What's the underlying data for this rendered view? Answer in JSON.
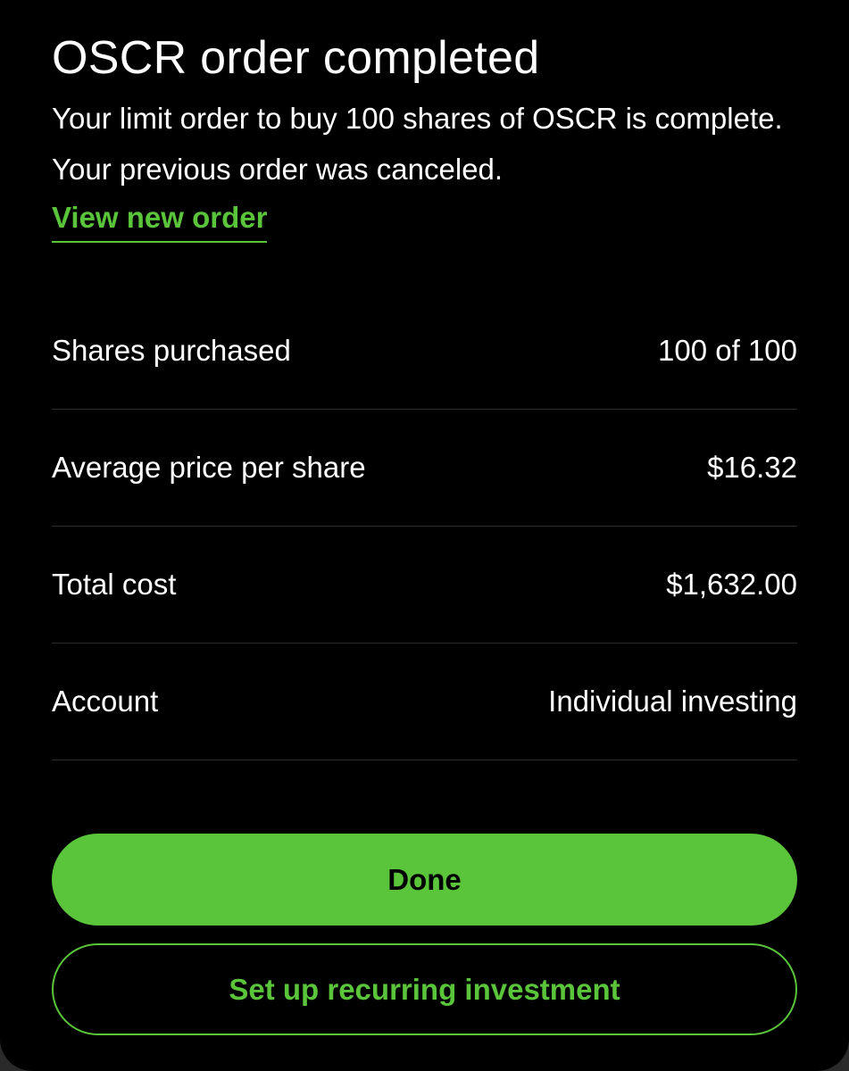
{
  "header": {
    "title": "OSCR order completed",
    "message": "Your limit order to buy 100 shares of OSCR is complete. Your previous order was canceled.",
    "link_label": "View new order"
  },
  "details": [
    {
      "label": "Shares purchased",
      "value": "100 of 100"
    },
    {
      "label": "Average price per share",
      "value": "$16.32"
    },
    {
      "label": "Total cost",
      "value": "$1,632.00"
    },
    {
      "label": "Account",
      "value": "Individual investing"
    }
  ],
  "actions": {
    "primary_label": "Done",
    "secondary_label": "Set up recurring investment"
  },
  "colors": {
    "accent": "#5ac53b",
    "background": "#000000",
    "text": "#ffffff",
    "divider": "#2c2c2e"
  }
}
